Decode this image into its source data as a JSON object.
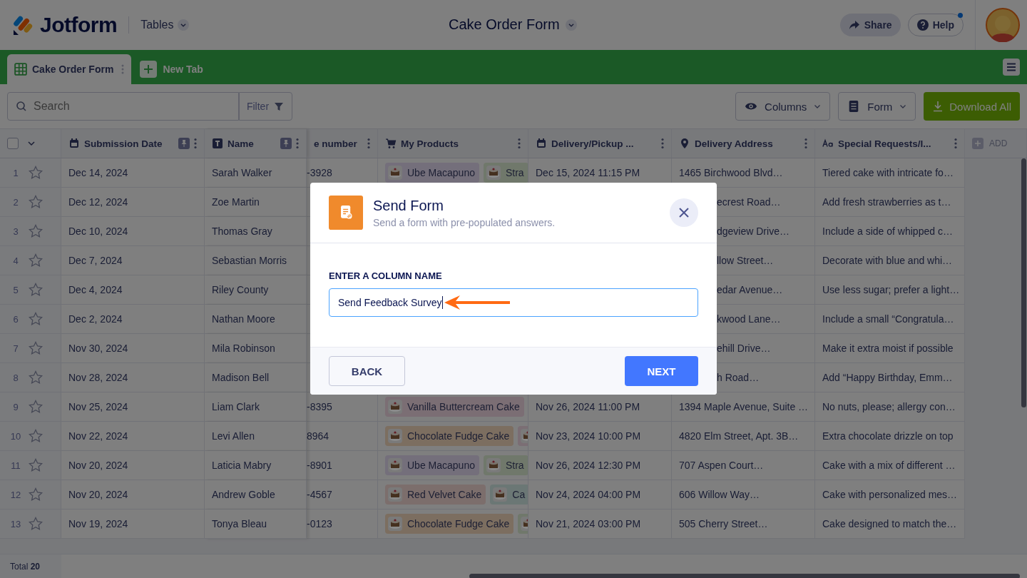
{
  "header": {
    "logo": "Jotform",
    "section": "Tables",
    "title": "Cake Order Form",
    "share": "Share",
    "help": "Help",
    "help_notification": true
  },
  "tabs": [
    {
      "label": "Cake Order Form",
      "selected": true
    }
  ],
  "new_tab": "New Tab",
  "toolbar": {
    "search_placeholder": "Search",
    "filter": "Filter",
    "columns": "Columns",
    "form": "Form",
    "download": "Download All"
  },
  "table": {
    "select_all_checked": false,
    "columns": [
      {
        "label": "Submission Date",
        "kind": "date",
        "pinned": true
      },
      {
        "label": "Name",
        "kind": "text",
        "pinned": true
      },
      {
        "label": "e number",
        "kind": "phone",
        "pinned": false
      },
      {
        "label": "My Products",
        "kind": "products",
        "pinned": false
      },
      {
        "label": "Delivery/Pickup ...",
        "kind": "date",
        "pinned": false
      },
      {
        "label": "Delivery Address",
        "kind": "address",
        "pinned": false
      },
      {
        "label": "Special Requests/I...",
        "kind": "paragraph",
        "pinned": false
      }
    ],
    "add_column": "ADD",
    "rows": [
      {
        "num": "1",
        "starred": false,
        "date": "Dec 14, 2024",
        "name": "Sarah Walker",
        "phone": "-3928",
        "products": [
          {
            "label": "Ube Macapuno",
            "color": "#746f7b"
          },
          {
            "label": "Stra",
            "color": "#70786b"
          }
        ],
        "delivery": "Dec 15, 2024 11:15 PM",
        "address": "1465 Birchwood Blvd…",
        "special": "Tiered cake with intricate fo…"
      },
      {
        "num": "2",
        "starred": false,
        "date": "Dec 12, 2024",
        "name": "Zoe Martin",
        "address": "ecrest Road…",
        "special": "Add fresh strawberries as t…"
      },
      {
        "num": "3",
        "starred": false,
        "date": "Dec 10, 2024",
        "name": "Thomas Gray",
        "address": "dgeview Drive…",
        "special": "Include a side of whipped c…"
      },
      {
        "num": "4",
        "starred": false,
        "date": "Dec 7, 2024",
        "name": "Sebastian Morris",
        "address": "llow Street…",
        "special": "Decorate with blue and whi…"
      },
      {
        "num": "5",
        "starred": false,
        "date": "Dec 4, 2024",
        "name": "Riley County",
        "address": "edar Avenue…",
        "special": "Use less sugar; prefer a light…"
      },
      {
        "num": "6",
        "starred": false,
        "date": "Dec 2, 2024",
        "name": "Nathan Moore",
        "address": "kwood Lane…",
        "special": "Include a small “Congratula…"
      },
      {
        "num": "7",
        "starred": false,
        "date": "Nov 30, 2024",
        "name": "Mila Robinson",
        "address": "ehill Drive…",
        "special": "Make it extra moist if possible"
      },
      {
        "num": "8",
        "starred": false,
        "date": "Nov 28, 2024",
        "name": "Madison Bell",
        "address": "h Road…",
        "special": "Add “Happy Birthday, Emm…"
      },
      {
        "num": "9",
        "starred": false,
        "date": "Nov 25, 2024",
        "name": "Liam Clark",
        "phone": "-8395",
        "products": [
          {
            "label": "Vanilla Buttercream Cake",
            "color": "#7b6e74"
          }
        ],
        "delivery": "Nov 26, 2024 11:00 PM",
        "address": "1394 Maple Avenue, Suite …",
        "special": "No nuts, please; allergy con…"
      },
      {
        "num": "10",
        "starred": false,
        "date": "Nov 22, 2024",
        "name": "Levi Allen",
        "phone": "8964",
        "products": [
          {
            "label": "Chocolate Fudge Cake",
            "color": "#7c6e60"
          },
          {
            "color": "#7b6e74"
          }
        ],
        "delivery": "Nov 23, 2024 10:00 PM",
        "address": "4820 Elm Street, Apt. 3B…",
        "special": "Extra chocolate drizzle on top"
      },
      {
        "num": "11",
        "starred": false,
        "date": "Nov 20, 2024",
        "name": "Laticia Mabry",
        "phone": "-8901",
        "products": [
          {
            "label": "Ube Macapuno",
            "color": "#746f7b"
          },
          {
            "label": "Stra",
            "color": "#70786b"
          }
        ],
        "delivery": "Nov 26, 2024 12:30 PM",
        "address": "707 Aspen Court…",
        "special": "Cake with a mix of different …"
      },
      {
        "num": "12",
        "starred": false,
        "date": "Nov 20, 2024",
        "name": "Andrew Goble",
        "phone": "-4567",
        "products": [
          {
            "label": "Red Velvet Cake",
            "color": "#7c6e6c"
          },
          {
            "label": "Ca",
            "color": "#6b7775"
          }
        ],
        "delivery": "Nov 24, 2024 04:00 PM",
        "address": "606 Willow Way…",
        "special": "Cake with personalized mes…"
      },
      {
        "num": "13",
        "starred": false,
        "date": "Nov 19, 2024",
        "name": "Tonya Bleau",
        "phone": "-0123",
        "products": [
          {
            "label": "Chocolate Fudge Cake",
            "color": "#7c6e60"
          },
          {
            "color": "#70786b"
          }
        ],
        "delivery": "Nov 21, 2024 03:00 PM",
        "address": "505 Cherry Street…",
        "special": "Cake designed to match the…"
      }
    ],
    "total": "Total **20**"
  },
  "dialog": {
    "title": "Send Form",
    "subtitle": "Send a form with pre-populated answers.",
    "label": "ENTER A COLUMN NAME",
    "value": "Send Feedback Survey",
    "back": "BACK",
    "next": "NEXT"
  }
}
